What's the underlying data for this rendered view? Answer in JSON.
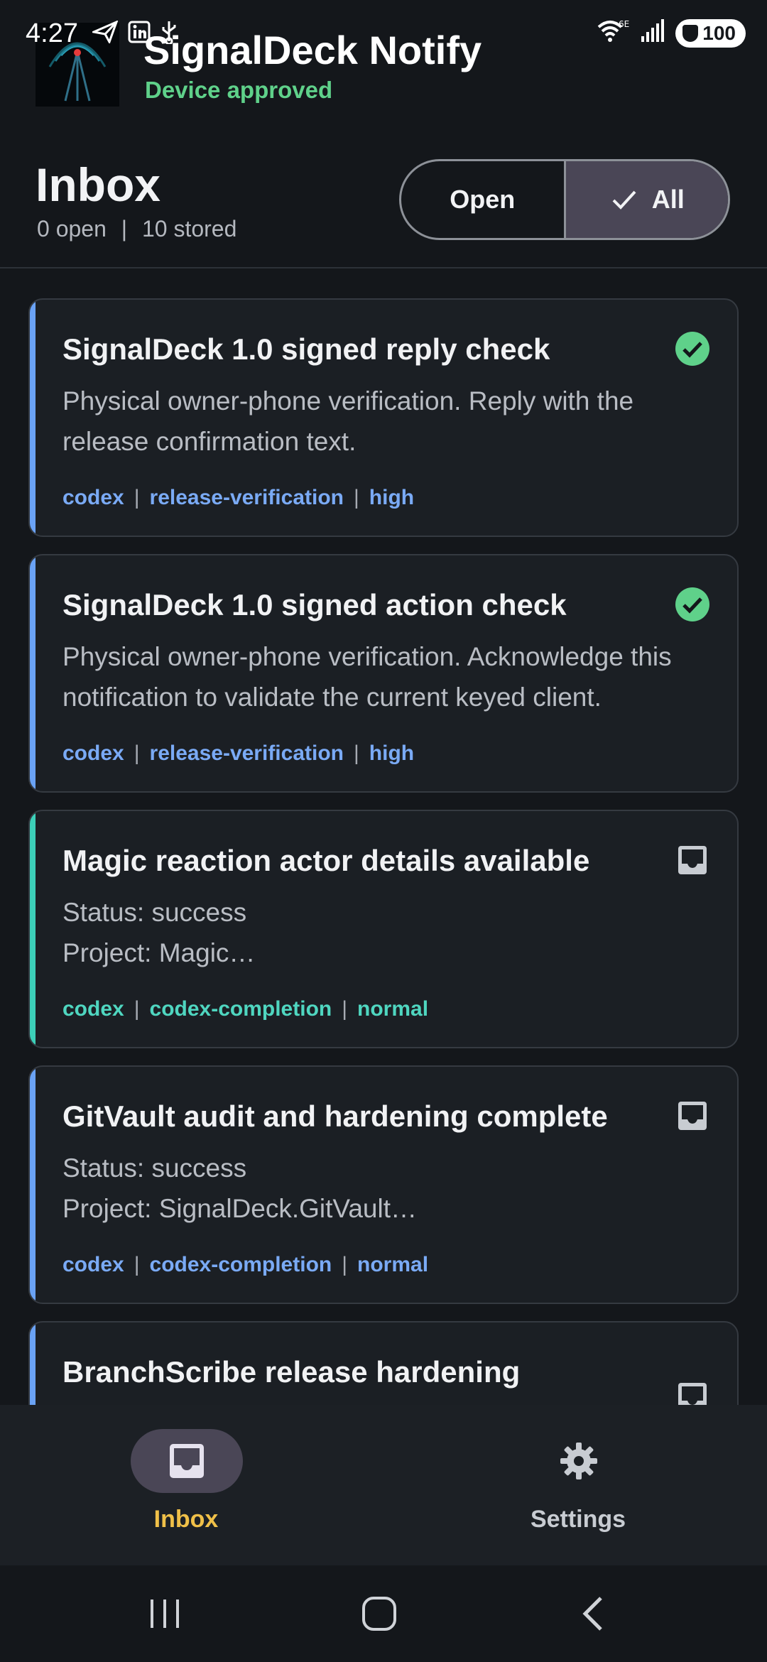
{
  "status_bar": {
    "time": "4:27",
    "battery": "100",
    "network": "6E"
  },
  "header": {
    "app_title": "SignalDeck Notify",
    "subtitle": "Device approved"
  },
  "inbox": {
    "title": "Inbox",
    "open_count": "0 open",
    "stored_count": "10 stored",
    "separator": "|",
    "filter": {
      "open_label": "Open",
      "all_label": "All",
      "selected": "All"
    }
  },
  "notifications": [
    {
      "title": "SignalDeck 1.0 signed reply check",
      "body": "Physical owner-phone verification. Reply with the release confirmation text.",
      "source": "codex",
      "category": "release-verification",
      "priority": "high",
      "status_icon": "check-circle-icon",
      "accent_color": "#6aa2f5",
      "tag_color": "#7aaaf5"
    },
    {
      "title": "SignalDeck 1.0 signed action check",
      "body": "Physical owner-phone verification. Acknowledge this notification to validate the current keyed client.",
      "source": "codex",
      "category": "release-verification",
      "priority": "high",
      "status_icon": "check-circle-icon",
      "accent_color": "#6aa2f5",
      "tag_color": "#7aaaf5"
    },
    {
      "title": "Magic reaction actor details available",
      "body_line1": "Status: success",
      "body_line2": "Project: Magic…",
      "source": "codex",
      "category": "codex-completion",
      "priority": "normal",
      "status_icon": "inbox-tray-icon",
      "accent_color": "#3ccfb8",
      "tag_color": "#4fd6c0"
    },
    {
      "title": "GitVault audit and hardening complete",
      "body_line1": "Status: success",
      "body_line2": "Project: SignalDeck.GitVault…",
      "source": "codex",
      "category": "codex-completion",
      "priority": "normal",
      "status_icon": "inbox-tray-icon",
      "accent_color": "#6aa2f5",
      "tag_color": "#7aaaf5"
    },
    {
      "title": "BranchScribe release hardening",
      "status_icon": "inbox-tray-icon",
      "accent_color": "#6aa2f5"
    }
  ],
  "bottom_nav": {
    "inbox_label": "Inbox",
    "settings_label": "Settings",
    "active": "Inbox"
  },
  "colors": {
    "background": "#14171b",
    "approved_green": "#5fd18a",
    "active_nav": "#f0c048",
    "check_green": "#5fd18a",
    "selected_pill": "#4a4656"
  }
}
